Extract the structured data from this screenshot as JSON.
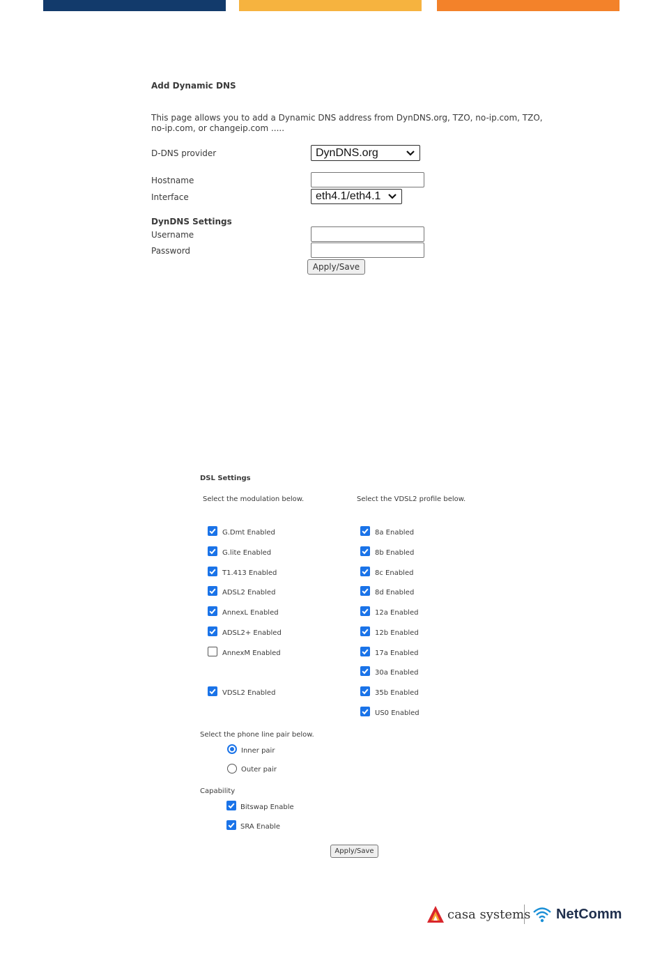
{
  "colors": {
    "blue": "#123a6b",
    "yellow": "#f6b33f",
    "orange": "#f3822a",
    "checkbox_accent": "#1a73e8"
  },
  "ddns": {
    "title": "Add Dynamic DNS",
    "description_line1": "This page allows you to add a Dynamic DNS address from DynDNS.org, TZO, no-ip.com, TZO,",
    "description_line2": "no-ip.com, or changeip.com .....",
    "provider_label": "D-DNS provider",
    "provider_value": "DynDNS.org",
    "hostname_label": "Hostname",
    "hostname_value": "",
    "interface_label": "Interface",
    "interface_value": "eth4.1/eth4.1",
    "settings_heading": "DynDNS Settings",
    "username_label": "Username",
    "username_value": "",
    "password_label": "Password",
    "password_value": "",
    "apply_label": "Apply/Save"
  },
  "dsl": {
    "title": "DSL Settings",
    "modulation_prompt": "Select the modulation below.",
    "vdsl2_prompt": "Select the VDSL2 profile below.",
    "modulations": [
      {
        "label": "G.Dmt Enabled",
        "checked": true
      },
      {
        "label": "G.lite Enabled",
        "checked": true
      },
      {
        "label": "T1.413 Enabled",
        "checked": true
      },
      {
        "label": "ADSL2 Enabled",
        "checked": true
      },
      {
        "label": "AnnexL Enabled",
        "checked": true
      },
      {
        "label": "ADSL2+ Enabled",
        "checked": true
      },
      {
        "label": "AnnexM Enabled",
        "checked": false
      },
      {
        "label": "VDSL2 Enabled",
        "checked": true
      }
    ],
    "profiles": [
      {
        "label": "8a Enabled",
        "checked": true
      },
      {
        "label": "8b Enabled",
        "checked": true
      },
      {
        "label": "8c Enabled",
        "checked": true
      },
      {
        "label": "8d Enabled",
        "checked": true
      },
      {
        "label": "12a Enabled",
        "checked": true
      },
      {
        "label": "12b Enabled",
        "checked": true
      },
      {
        "label": "17a Enabled",
        "checked": true
      },
      {
        "label": "30a Enabled",
        "checked": true
      },
      {
        "label": "35b Enabled",
        "checked": true
      },
      {
        "label": "US0 Enabled",
        "checked": true
      }
    ],
    "phone_pair_prompt": "Select the phone line pair below.",
    "pairs": [
      {
        "label": "Inner pair",
        "selected": true
      },
      {
        "label": "Outer pair",
        "selected": false
      }
    ],
    "capability_label": "Capability",
    "capabilities": [
      {
        "label": "Bitswap Enable",
        "checked": true
      },
      {
        "label": "SRA Enable",
        "checked": true
      }
    ],
    "apply_label": "Apply/Save"
  },
  "footer": {
    "casa_text": "casa systems",
    "netcomm_text": "NetComm"
  }
}
